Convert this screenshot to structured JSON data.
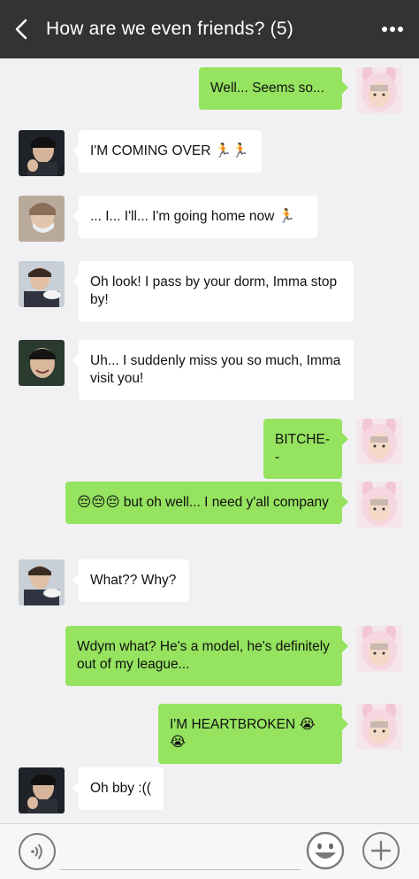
{
  "header": {
    "title": "How are we even friends? (5)",
    "back_icon": "chevron-left-icon",
    "more_icon": "more-dots-icon"
  },
  "messages": [
    {
      "side": "out",
      "sender": "me",
      "text": "Well... Seems so..."
    },
    {
      "side": "in",
      "sender": "friend-selfie",
      "text": "I'M COMING OVER 🏃🏃"
    },
    {
      "side": "in",
      "sender": "friend-mask",
      "text": "... I... I'll... I'm going home now 🏃"
    },
    {
      "side": "in",
      "sender": "friend-eating",
      "text": "Oh look! I pass by your dorm, Imma stop by!"
    },
    {
      "side": "in",
      "sender": "friend-smile",
      "text": "Uh... I suddenly miss you so much, Imma visit you!"
    },
    {
      "side": "out",
      "sender": "me",
      "text": "BITCHE--"
    },
    {
      "side": "out",
      "sender": "me",
      "text": "😔😔😔 but oh well... I need y'all company"
    },
    {
      "side": "in",
      "sender": "friend-eating",
      "text": "What?? Why?"
    },
    {
      "side": "out",
      "sender": "me",
      "text": "Wdym what? He's a model, he's definitely out of my league..."
    },
    {
      "side": "out",
      "sender": "me",
      "text": "I'M HEARTBROKEN 😭😭"
    },
    {
      "side": "in",
      "sender": "friend-selfie",
      "text": "Oh bby :(("
    }
  ],
  "input": {
    "placeholder": "",
    "value": ""
  },
  "footer": {
    "voice_icon": "voice-icon",
    "emoji_icon": "emoji-icon",
    "plus_icon": "plus-icon"
  },
  "colors": {
    "header_bg": "#333333",
    "outgoing_bubble": "#95e35f",
    "incoming_bubble": "#ffffff",
    "chat_bg": "#f1f1f3"
  }
}
